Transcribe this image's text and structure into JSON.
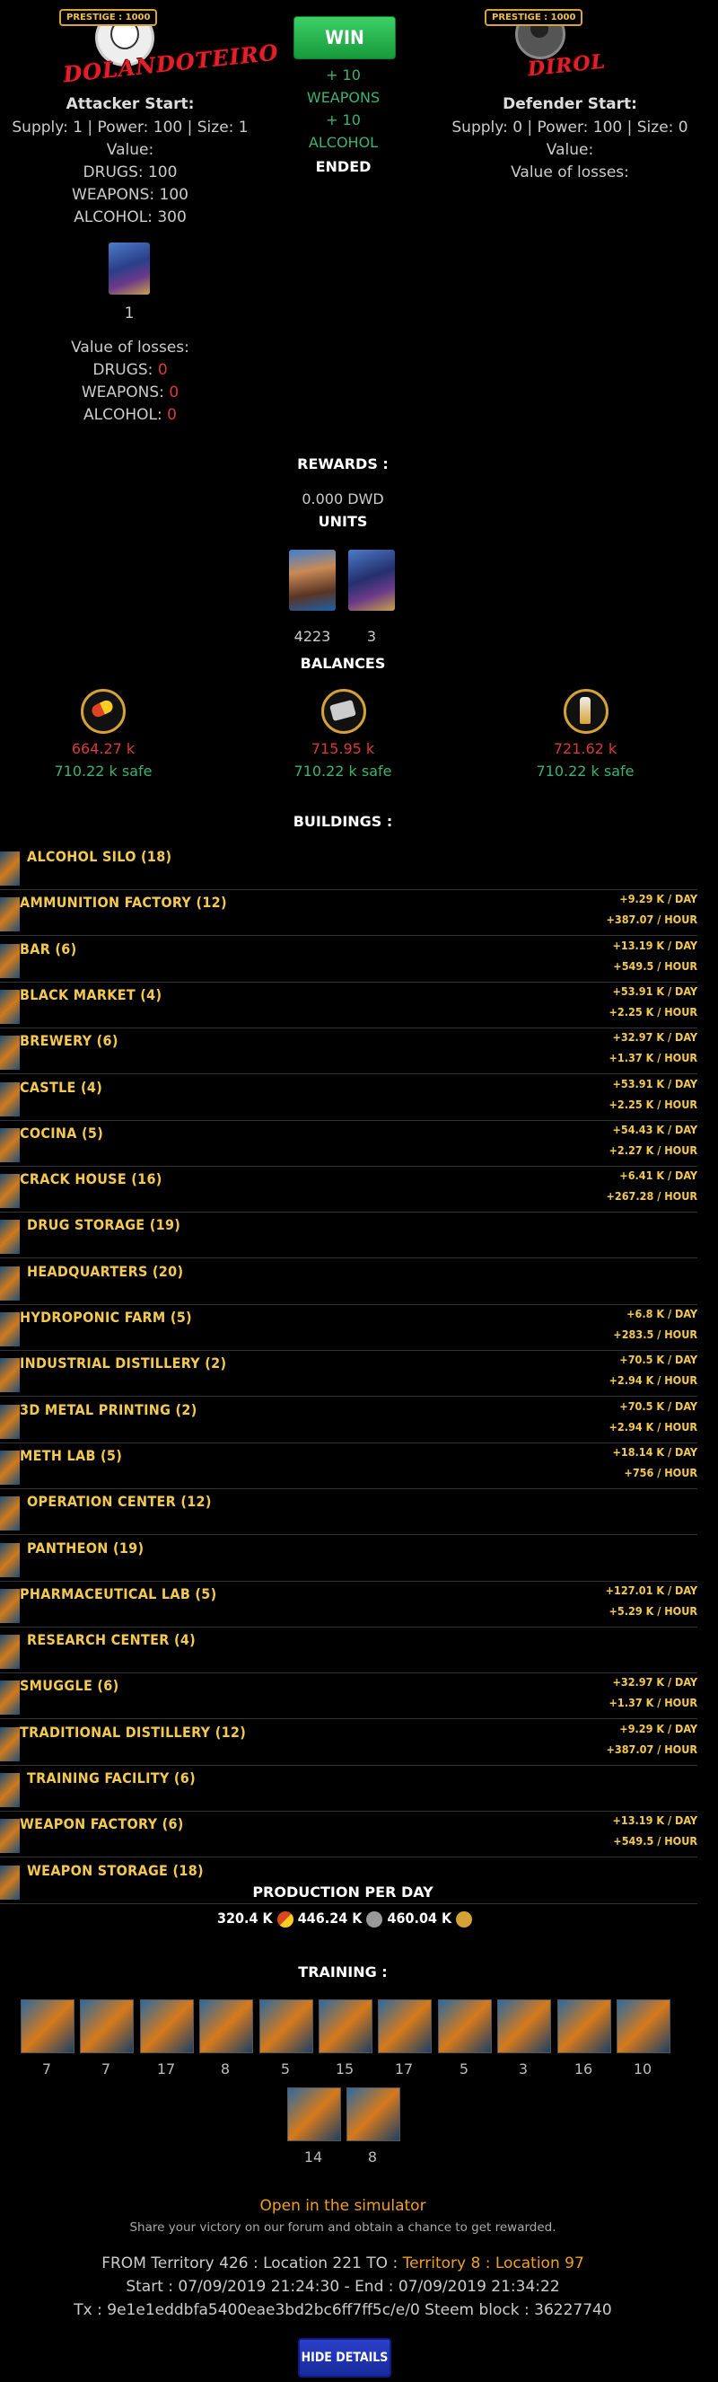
{
  "attacker": {
    "prestige": "PRESTIGE : 1000",
    "name": "DOLANDOTEIRO",
    "start_label": "Attacker Start:",
    "supply_line": "Supply: 1 | Power: 100 | Size: 1",
    "value_label": "Value:",
    "drugs": "DRUGS: 100",
    "weapons": "WEAPONS: 100",
    "alcohol": "ALCOHOL: 300",
    "unit_count": "1",
    "losses_label": "Value of losses:",
    "loss_drugs_label": "DRUGS:",
    "loss_drugs": "0",
    "loss_weapons_label": "WEAPONS:",
    "loss_weapons": "0",
    "loss_alcohol_label": "ALCOHOL:",
    "loss_alcohol": "0"
  },
  "result": {
    "status": "WIN",
    "gain1": "+ 10",
    "gain1_label": "WEAPONS",
    "gain2": "+ 10",
    "gain2_label": "ALCOHOL",
    "state": "ENDED"
  },
  "defender": {
    "prestige": "PRESTIGE : 1000",
    "name": "DIROL",
    "start_label": "Defender Start:",
    "supply_line": "Supply: 0 | Power: 100 | Size: 0",
    "value_label": "Value:",
    "losses_label": "Value of losses:"
  },
  "rewards": {
    "title": "REWARDS :",
    "dwd": "0.000 DWD",
    "units_title": "UNITS",
    "unit_counts": [
      "4223",
      "3"
    ],
    "balances_title": "BALANCES",
    "balances": [
      {
        "icon": "drugs-icon",
        "value": "664.27 k",
        "safe": "710.22 k safe"
      },
      {
        "icon": "weapons-icon",
        "value": "715.95 k",
        "safe": "710.22 k safe"
      },
      {
        "icon": "alcohol-icon",
        "value": "721.62 k",
        "safe": "710.22 k safe"
      }
    ]
  },
  "buildings": {
    "title": "BUILDINGS :",
    "items": [
      {
        "name": "ALCOHOL SILO (18)",
        "day": "",
        "hour": ""
      },
      {
        "name": "AMMUNITION FACTORY (12)",
        "day": "+9.29 K / DAY",
        "hour": "+387.07 / HOUR"
      },
      {
        "name": "BAR (6)",
        "day": "+13.19 K / DAY",
        "hour": "+549.5 / HOUR"
      },
      {
        "name": "BLACK MARKET (4)",
        "day": "+53.91 K / DAY",
        "hour": "+2.25 K / HOUR"
      },
      {
        "name": "BREWERY (6)",
        "day": "+32.97 K / DAY",
        "hour": "+1.37 K / HOUR"
      },
      {
        "name": "CASTLE (4)",
        "day": "+53.91 K / DAY",
        "hour": "+2.25 K / HOUR"
      },
      {
        "name": "COCINA (5)",
        "day": "+54.43 K / DAY",
        "hour": "+2.27 K / HOUR"
      },
      {
        "name": "CRACK HOUSE (16)",
        "day": "+6.41 K / DAY",
        "hour": "+267.28 / HOUR"
      },
      {
        "name": "DRUG STORAGE (19)",
        "day": "",
        "hour": ""
      },
      {
        "name": "HEADQUARTERS (20)",
        "day": "",
        "hour": ""
      },
      {
        "name": "HYDROPONIC FARM (5)",
        "day": "+6.8 K / DAY",
        "hour": "+283.5 / HOUR"
      },
      {
        "name": "INDUSTRIAL DISTILLERY (2)",
        "day": "+70.5 K / DAY",
        "hour": "+2.94 K / HOUR"
      },
      {
        "name": "3D METAL PRINTING (2)",
        "day": "+70.5 K / DAY",
        "hour": "+2.94 K / HOUR"
      },
      {
        "name": "METH LAB (5)",
        "day": "+18.14 K / DAY",
        "hour": "+756 / HOUR"
      },
      {
        "name": "OPERATION CENTER (12)",
        "day": "",
        "hour": ""
      },
      {
        "name": "PANTHEON (19)",
        "day": "",
        "hour": ""
      },
      {
        "name": "PHARMACEUTICAL LAB (5)",
        "day": "+127.01 K / DAY",
        "hour": "+5.29 K / HOUR"
      },
      {
        "name": "RESEARCH CENTER (4)",
        "day": "",
        "hour": ""
      },
      {
        "name": "SMUGGLE (6)",
        "day": "+32.97 K / DAY",
        "hour": "+1.37 K / HOUR"
      },
      {
        "name": "TRADITIONAL DISTILLERY (12)",
        "day": "+9.29 K / DAY",
        "hour": "+387.07 / HOUR"
      },
      {
        "name": "TRAINING FACILITY (6)",
        "day": "",
        "hour": ""
      },
      {
        "name": "WEAPON FACTORY (6)",
        "day": "+13.19 K / DAY",
        "hour": "+549.5 / HOUR"
      },
      {
        "name": "WEAPON STORAGE (18)",
        "day": "",
        "hour": ""
      }
    ]
  },
  "production": {
    "title": "PRODUCTION PER DAY",
    "drugs": "320.4 K",
    "weapons": "446.24 K",
    "alcohol": "460.04 K"
  },
  "training": {
    "title": "TRAINING :",
    "counts": [
      "7",
      "7",
      "17",
      "8",
      "5",
      "15",
      "17",
      "5",
      "3",
      "16",
      "10",
      "14",
      "8"
    ]
  },
  "footer": {
    "simulator_link": "Open in the simulator",
    "share_text": "Share your victory on our forum and obtain a chance to get rewarded.",
    "from_prefix": "FROM Territory 426 : Location 221 TO :",
    "to_target": "Territory 8 : Location 97",
    "times": "Start : 07/09/2019 21:24:30 - End : 07/09/2019 21:34:22",
    "tx": "Tx : 9e1e1eddbfa5400eae3bd2bc6ff7ff5c/e/0 Steem block : 36227740",
    "hide_button": "HIDE DETAILS"
  },
  "colors": {
    "accent_gold": "#f3c94f",
    "win_green": "#2fbf55",
    "loss_red": "#d83a3a",
    "safe_green": "#3cb371",
    "button_blue": "#1f34b5"
  }
}
